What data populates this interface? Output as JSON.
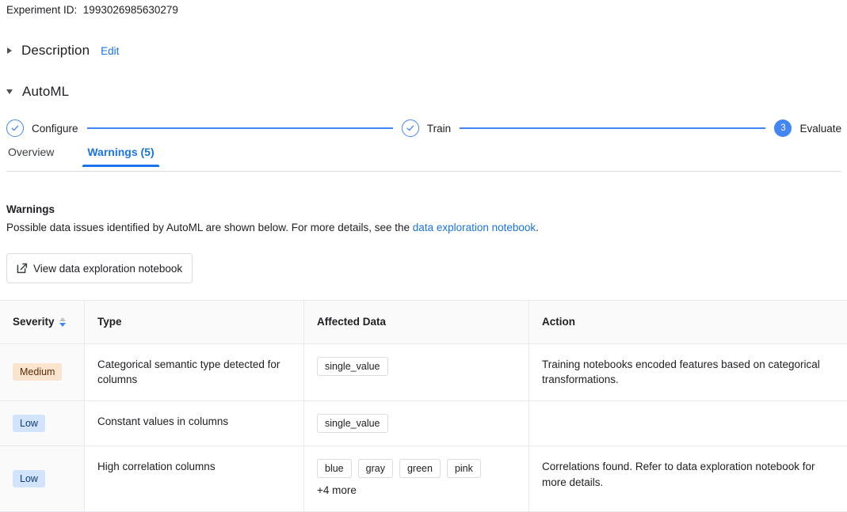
{
  "experiment": {
    "id_label": "Experiment ID:",
    "id_value": "1993026985630279"
  },
  "sections": {
    "description": {
      "title": "Description",
      "edit_label": "Edit",
      "expanded": false
    },
    "automl": {
      "title": "AutoML",
      "expanded": true
    }
  },
  "stepper": {
    "steps": [
      {
        "label": "Configure",
        "state": "done",
        "marker": "check"
      },
      {
        "label": "Train",
        "state": "done",
        "marker": "check"
      },
      {
        "label": "Evaluate",
        "state": "active",
        "marker": "3"
      }
    ],
    "accent_color": "#4285f4"
  },
  "tabs": [
    {
      "label": "Overview",
      "active": false
    },
    {
      "label": "Warnings (5)",
      "active": true
    }
  ],
  "warnings_panel": {
    "heading": "Warnings",
    "description_before": "Possible data issues identified by AutoML are shown below. For more details, see the ",
    "description_link": "data exploration notebook",
    "description_after": ".",
    "notebook_button": "View data exploration notebook"
  },
  "table": {
    "columns": [
      {
        "label": "Severity",
        "sortable": true,
        "sort_direction": "desc"
      },
      {
        "label": "Type",
        "sortable": false
      },
      {
        "label": "Affected Data",
        "sortable": false
      },
      {
        "label": "Action",
        "sortable": false
      }
    ],
    "rows": [
      {
        "severity": "Medium",
        "severity_level": "medium",
        "type": "Categorical semantic type detected for columns",
        "affected_data": [
          "single_value"
        ],
        "more_label": "",
        "action": "Training notebooks encoded features based on categorical transformations."
      },
      {
        "severity": "Low",
        "severity_level": "low",
        "type": "Constant values in columns",
        "affected_data": [
          "single_value"
        ],
        "more_label": "",
        "action": ""
      },
      {
        "severity": "Low",
        "severity_level": "low",
        "type": "High correlation columns",
        "affected_data": [
          "blue",
          "gray",
          "green",
          "pink"
        ],
        "more_label": "+4 more",
        "action": "Correlations found. Refer to data exploration notebook for more details."
      }
    ]
  },
  "colors": {
    "link": "#1a73e8",
    "accent": "#4285f4",
    "badge_medium_bg": "#fae4cd",
    "badge_medium_fg": "#5c2b06",
    "badge_low_bg": "#d2e3fc",
    "badge_low_fg": "#13397d",
    "border": "#e8eaed"
  }
}
